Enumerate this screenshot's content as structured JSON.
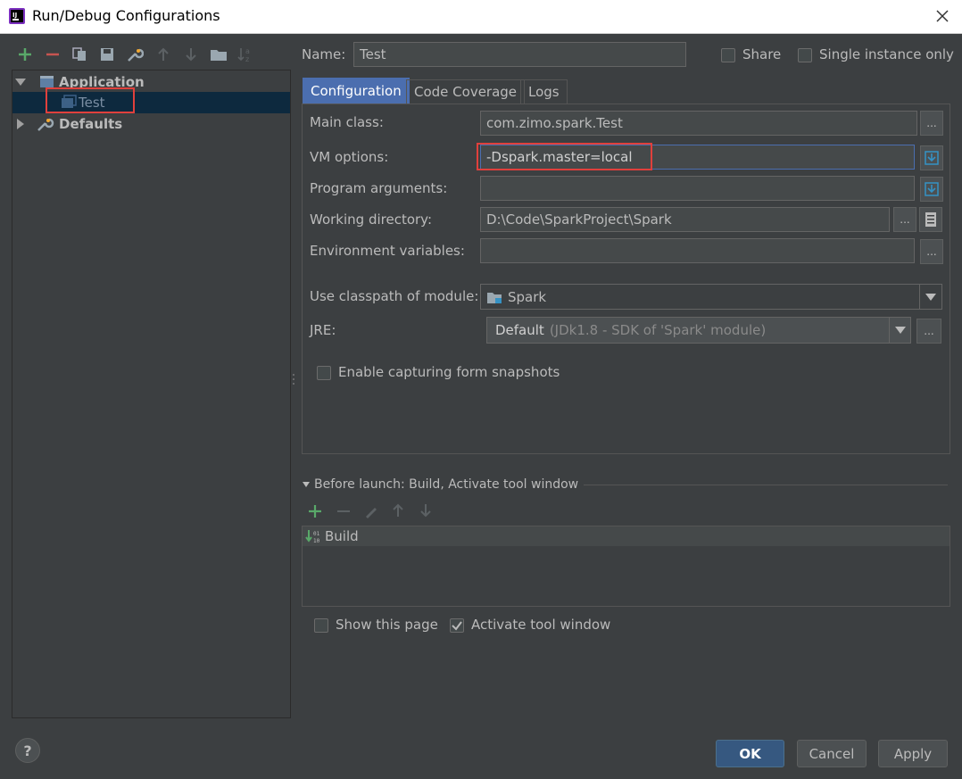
{
  "window": {
    "title": "Run/Debug Configurations"
  },
  "tree": {
    "application_label": "Application",
    "test_label": "Test",
    "defaults_label": "Defaults"
  },
  "header": {
    "name_label": "Name:",
    "name_value": "Test",
    "share_label": "Share",
    "single_instance_label": "Single instance only"
  },
  "tabs": [
    {
      "label": "Configuration"
    },
    {
      "label": "Code Coverage"
    },
    {
      "label": "Logs"
    }
  ],
  "config": {
    "main_class_label": "Main class:",
    "main_class_value": "com.zimo.spark.Test",
    "vm_options_label": "VM options:",
    "vm_options_value": "-Dspark.master=local",
    "program_args_label": "Program arguments:",
    "program_args_value": "",
    "working_dir_label": "Working directory:",
    "working_dir_value": "D:\\Code\\SparkProject\\Spark",
    "env_vars_label": "Environment variables:",
    "env_vars_value": "",
    "classpath_label": "Use classpath of module:",
    "classpath_value": "Spark",
    "jre_label": "JRE:",
    "jre_value": "Default",
    "jre_detail": "(JDk1.8 - SDK of 'Spark' module)",
    "snapshots_label": "Enable capturing form snapshots",
    "dots": "..."
  },
  "before_launch": {
    "header": "Before launch: Build, Activate tool window",
    "items": [
      "Build"
    ],
    "show_page_label": "Show this page",
    "activate_label": "Activate tool window"
  },
  "buttons": {
    "ok": "OK",
    "cancel": "Cancel",
    "apply": "Apply",
    "help": "?"
  },
  "colors": {
    "accent_add": "#59a869",
    "accent_remove": "#c75450",
    "highlight_box": "#e0403c",
    "selection": "#0d293e"
  }
}
